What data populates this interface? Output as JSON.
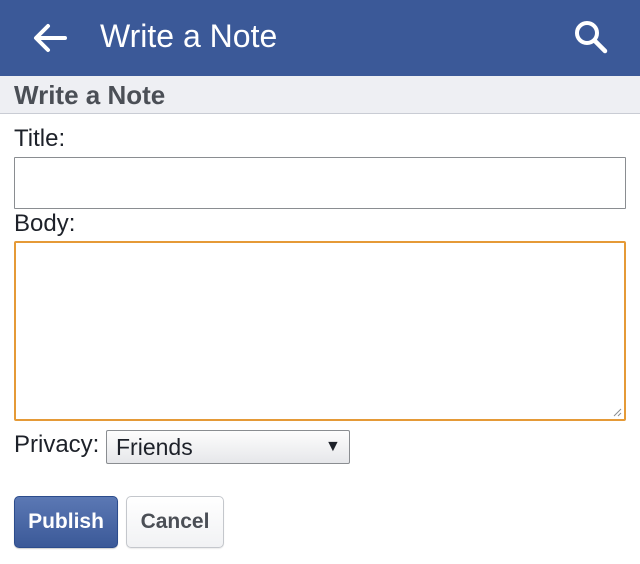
{
  "app_bar": {
    "title": "Write a Note",
    "back_icon": "arrow-left-icon",
    "search_icon": "search-icon",
    "background_color": "#3b5998"
  },
  "section": {
    "title": "Write a Note"
  },
  "form": {
    "title_label": "Title:",
    "title_value": "",
    "body_label": "Body:",
    "body_value": "",
    "privacy_label": "Privacy:",
    "privacy_selected": "Friends",
    "focus_color": "#e59a37"
  },
  "actions": {
    "publish_label": "Publish",
    "cancel_label": "Cancel"
  }
}
